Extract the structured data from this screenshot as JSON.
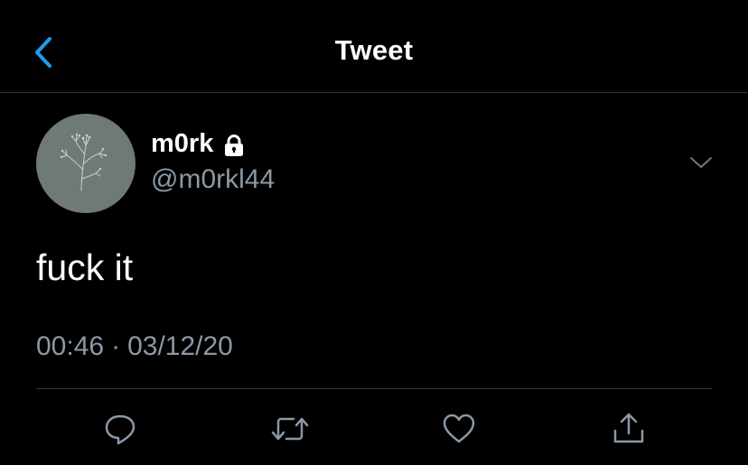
{
  "header": {
    "title": "Tweet",
    "back_icon": "chevron-left-icon",
    "accent_color": "#1d9bf0"
  },
  "tweet": {
    "display_name": "m0rk",
    "protected_icon": "lock-icon",
    "handle": "@m0rkl44",
    "text": "fuck it",
    "time": "00:46",
    "separator": "·",
    "date": "03/12/20",
    "menu_icon": "chevron-down-icon"
  },
  "actions": [
    {
      "icon": "reply-icon"
    },
    {
      "icon": "retweet-icon"
    },
    {
      "icon": "like-icon"
    },
    {
      "icon": "share-icon"
    }
  ],
  "colors": {
    "background": "#000000",
    "text": "#ffffff",
    "secondary_text": "#8b98a5",
    "divider": "#2f3336",
    "avatar_bg": "#6e7a73"
  }
}
